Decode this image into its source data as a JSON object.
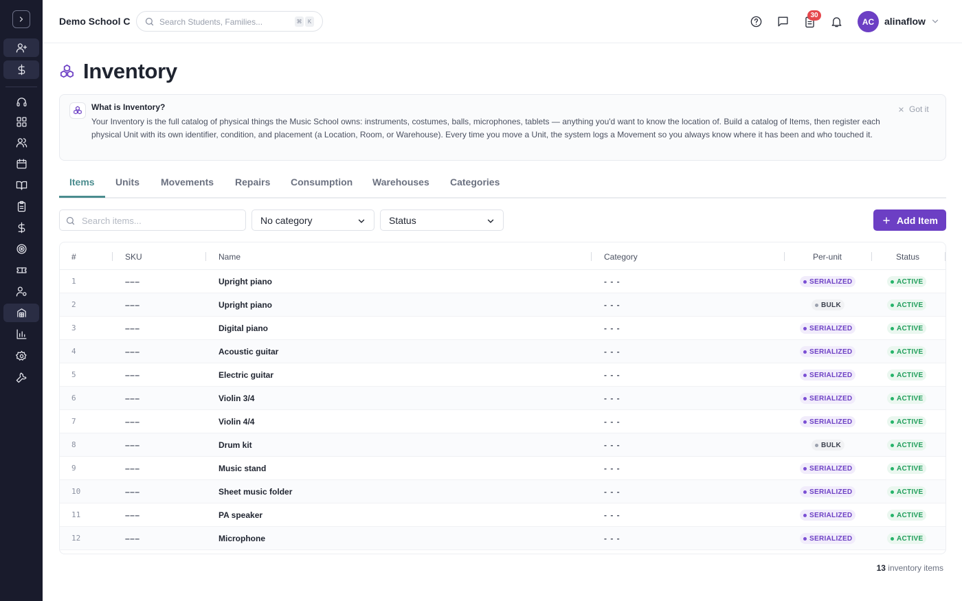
{
  "header": {
    "school_name": "Demo School C",
    "search_placeholder": "Search Students, Families...",
    "kbd_1": "⌘",
    "kbd_2": "K",
    "notification_count": "30",
    "user_initials": "AC",
    "user_name": "alinaflow"
  },
  "page": {
    "title": "Inventory"
  },
  "info": {
    "title": "What is Inventory?",
    "body": "Your Inventory is the full catalog of physical things the Music School owns: instruments, costumes, balls, microphones, tablets — anything you'd want to know the location of. Build a catalog of Items, then register each physical Unit with its own identifier, condition, and placement (a Location, Room, or Warehouse). Every time you move a Unit, the system logs a Movement so you always know where it has been and who touched it.",
    "dismiss_label": "Got it"
  },
  "tabs": [
    "Items",
    "Units",
    "Movements",
    "Repairs",
    "Consumption",
    "Warehouses",
    "Categories"
  ],
  "filters": {
    "search_placeholder": "Search items...",
    "category_value": "No category",
    "status_value": "Status",
    "add_label": "Add Item"
  },
  "table": {
    "columns": [
      "#",
      "SKU",
      "Name",
      "Category",
      "Per-unit",
      "Status"
    ],
    "rows": [
      {
        "num": "1",
        "sku": "–––",
        "name": "Upright piano",
        "category": "- - -",
        "per_unit": "SERIALIZED",
        "status": "ACTIVE"
      },
      {
        "num": "2",
        "sku": "–––",
        "name": "Upright piano",
        "category": "- - -",
        "per_unit": "BULK",
        "status": "ACTIVE"
      },
      {
        "num": "3",
        "sku": "–––",
        "name": "Digital piano",
        "category": "- - -",
        "per_unit": "SERIALIZED",
        "status": "ACTIVE"
      },
      {
        "num": "4",
        "sku": "–––",
        "name": "Acoustic guitar",
        "category": "- - -",
        "per_unit": "SERIALIZED",
        "status": "ACTIVE"
      },
      {
        "num": "5",
        "sku": "–––",
        "name": "Electric guitar",
        "category": "- - -",
        "per_unit": "SERIALIZED",
        "status": "ACTIVE"
      },
      {
        "num": "6",
        "sku": "–––",
        "name": "Violin 3/4",
        "category": "- - -",
        "per_unit": "SERIALIZED",
        "status": "ACTIVE"
      },
      {
        "num": "7",
        "sku": "–––",
        "name": "Violin 4/4",
        "category": "- - -",
        "per_unit": "SERIALIZED",
        "status": "ACTIVE"
      },
      {
        "num": "8",
        "sku": "–––",
        "name": "Drum kit",
        "category": "- - -",
        "per_unit": "BULK",
        "status": "ACTIVE"
      },
      {
        "num": "9",
        "sku": "–––",
        "name": "Music stand",
        "category": "- - -",
        "per_unit": "SERIALIZED",
        "status": "ACTIVE"
      },
      {
        "num": "10",
        "sku": "–––",
        "name": "Sheet music folder",
        "category": "- - -",
        "per_unit": "SERIALIZED",
        "status": "ACTIVE"
      },
      {
        "num": "11",
        "sku": "–––",
        "name": "PA speaker",
        "category": "- - -",
        "per_unit": "SERIALIZED",
        "status": "ACTIVE"
      },
      {
        "num": "12",
        "sku": "–––",
        "name": "Microphone",
        "category": "- - -",
        "per_unit": "SERIALIZED",
        "status": "ACTIVE"
      }
    ]
  },
  "footer": {
    "count": "13",
    "count_label": "inventory items"
  },
  "colors": {
    "sidebar_bg": "#191b2c",
    "accent_purple": "#6c3fc4",
    "tab_active": "#4a8c8e",
    "active_green": "#1f9d5a",
    "notification_red": "#e5484d"
  },
  "icons": {
    "sidebar": [
      "chevron-right-icon",
      "user-plus-icon",
      "dollar-icon",
      "headset-icon",
      "dashboard-icon",
      "users-icon",
      "calendar-icon",
      "book-icon",
      "clipboard-icon",
      "dollar-icon",
      "target-icon",
      "ticket-icon",
      "user-gear-icon",
      "inventory-icon",
      "bar-chart-icon",
      "gear-icon",
      "wrench-icon"
    ],
    "header": [
      "help-icon",
      "message-icon",
      "clipboard-icon",
      "bell-icon"
    ]
  }
}
